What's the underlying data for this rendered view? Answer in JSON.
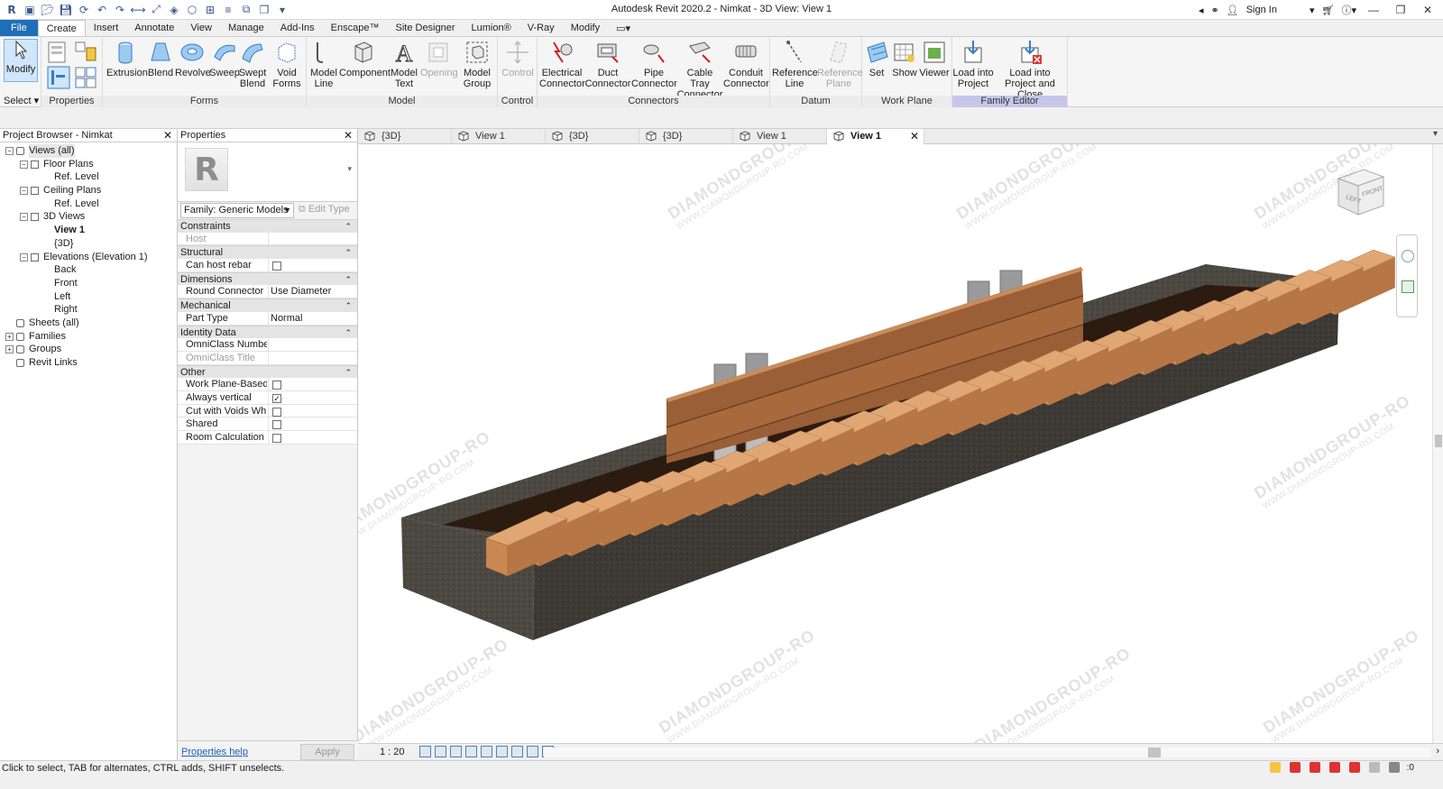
{
  "app": {
    "title": "Autodesk Revit 2020.2 - Nimkat - 3D View: View 1",
    "sign_in": "Sign In",
    "help_icon": "?"
  },
  "ribbon_tabs": [
    "File",
    "Create",
    "Insert",
    "Annotate",
    "View",
    "Manage",
    "Add-Ins",
    "Enscape™",
    "Site Designer",
    "Lumion®",
    "V-Ray",
    "Modify"
  ],
  "ribbon": {
    "select": {
      "modify": "Modify",
      "title": "Select ▾"
    },
    "properties": {
      "title": "Properties"
    },
    "forms": {
      "title": "Forms",
      "buttons": [
        "Extrusion",
        "Blend",
        "Revolve",
        "Sweep",
        "Swept Blend",
        "Void Forms"
      ]
    },
    "model": {
      "title": "Model",
      "buttons": [
        "Model Line",
        "Component",
        "Model Text",
        "Opening",
        "Model Group"
      ]
    },
    "control": {
      "title": "Control",
      "buttons": [
        "Control"
      ]
    },
    "connectors": {
      "title": "Connectors",
      "buttons": [
        "Electrical Connector",
        "Duct Connector",
        "Pipe Connector",
        "Cable Tray Connector",
        "Conduit Connector"
      ]
    },
    "datum": {
      "title": "Datum",
      "buttons": [
        "Reference Line",
        "Reference Plane"
      ]
    },
    "workplane": {
      "title": "Work Plane",
      "buttons": [
        "Set",
        "Show",
        "Viewer"
      ]
    },
    "family_editor": {
      "title": "Family Editor",
      "buttons": [
        "Load into Project",
        "Load into Project and Close"
      ]
    }
  },
  "project_browser": {
    "title": "Project Browser - Nimkat",
    "items": [
      {
        "label": "Views (all)",
        "level": 0,
        "toggle": "⊟",
        "selected": true
      },
      {
        "label": "Floor Plans",
        "level": 1,
        "toggle": "⊟"
      },
      {
        "label": "Ref. Level",
        "level": 2
      },
      {
        "label": "Ceiling Plans",
        "level": 1,
        "toggle": "⊟"
      },
      {
        "label": "Ref. Level",
        "level": 2
      },
      {
        "label": "3D Views",
        "level": 1,
        "toggle": "⊟"
      },
      {
        "label": "View 1",
        "level": 2,
        "bold": true
      },
      {
        "label": "{3D}",
        "level": 2
      },
      {
        "label": "Elevations (Elevation 1)",
        "level": 1,
        "toggle": "⊟"
      },
      {
        "label": "Back",
        "level": 2
      },
      {
        "label": "Front",
        "level": 2
      },
      {
        "label": "Left",
        "level": 2
      },
      {
        "label": "Right",
        "level": 2
      },
      {
        "label": "Sheets (all)",
        "level": 0
      },
      {
        "label": "Families",
        "level": 0,
        "toggle": "⊞"
      },
      {
        "label": "Groups",
        "level": 0,
        "toggle": "⊞"
      },
      {
        "label": "Revit Links",
        "level": 0
      }
    ]
  },
  "properties": {
    "title": "Properties",
    "family": "Family: Generic Models",
    "edit_type": "Edit Type",
    "categories": [
      {
        "name": "Constraints",
        "rows": [
          {
            "k": "Host",
            "v": "",
            "disabled": true
          }
        ]
      },
      {
        "name": "Structural",
        "rows": [
          {
            "k": "Can host rebar",
            "cb": false
          }
        ]
      },
      {
        "name": "Dimensions",
        "rows": [
          {
            "k": "Round Connector ...",
            "v": "Use Diameter"
          }
        ]
      },
      {
        "name": "Mechanical",
        "rows": [
          {
            "k": "Part Type",
            "v": "Normal"
          }
        ]
      },
      {
        "name": "Identity Data",
        "rows": [
          {
            "k": "OmniClass Number",
            "v": ""
          },
          {
            "k": "OmniClass Title",
            "v": "",
            "disabled": true
          }
        ]
      },
      {
        "name": "Other",
        "rows": [
          {
            "k": "Work Plane-Based",
            "cb": false
          },
          {
            "k": "Always vertical",
            "cb": true
          },
          {
            "k": "Cut with Voids Wh...",
            "cb": false
          },
          {
            "k": "Shared",
            "cb": false
          },
          {
            "k": "Room Calculation ...",
            "cb": false
          }
        ]
      }
    ],
    "help": "Properties help",
    "apply": "Apply"
  },
  "view_tabs": [
    {
      "label": "{3D}"
    },
    {
      "label": "View 1"
    },
    {
      "label": "{3D}"
    },
    {
      "label": "{3D}"
    },
    {
      "label": "View 1"
    },
    {
      "label": "View 1",
      "active": true
    }
  ],
  "viewcube": {
    "left": "LEFT",
    "front": "FRONT"
  },
  "view_bar": {
    "scale": "1 : 20"
  },
  "status": {
    "text": "Click to select, TAB for alternates, CTRL adds, SHIFT unselects.",
    "filter": ":0"
  },
  "watermark": {
    "line1": "DIAMONDGROUP-RO",
    "line2": "WWW.DIAMONDGROUP-RO.COM"
  },
  "colors": {
    "accent": "#1f6fb8",
    "wood": "#e0a774",
    "concrete": "#4a4640",
    "family_editor": "#c7c6ea"
  }
}
